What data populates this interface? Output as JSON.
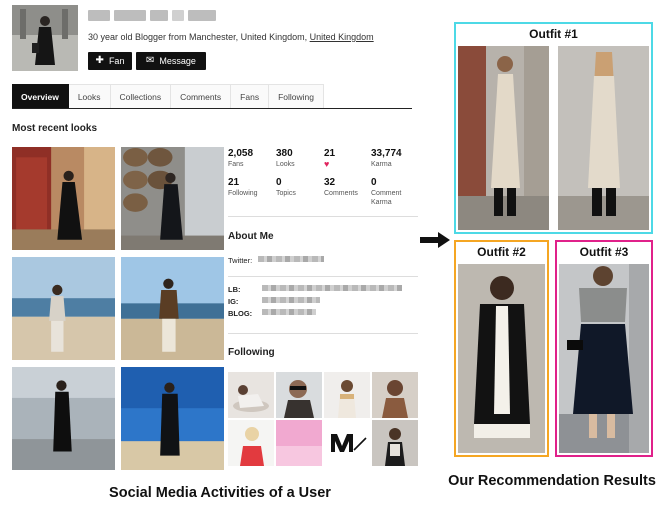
{
  "profile": {
    "bio": "30 year old Blogger from Manchester, United Kingdom, ",
    "bio_link": "United Kingdom",
    "fan_label": "Fan",
    "message_label": "Message"
  },
  "tabs": [
    "Overview",
    "Looks",
    "Collections",
    "Comments",
    "Fans",
    "Following"
  ],
  "recent_looks": {
    "heading": "Most recent looks"
  },
  "stats": [
    {
      "value": "2,058",
      "label": "Fans"
    },
    {
      "value": "380",
      "label": "Looks"
    },
    {
      "value": "21",
      "label": "♥"
    },
    {
      "value": "33,774",
      "label": "Karma"
    },
    {
      "value": "21",
      "label": "Following"
    },
    {
      "value": "0",
      "label": "Topics"
    },
    {
      "value": "32",
      "label": "Comments"
    },
    {
      "value": "0",
      "label": "Comment Karma"
    }
  ],
  "about": {
    "heading": "About Me",
    "twitter_label": "Twitter:",
    "lb_label": "LB:",
    "ig_label": "IG:",
    "blog_label": "BLOG:"
  },
  "following": {
    "heading": "Following"
  },
  "outfits": {
    "o1": {
      "title": "Outfit #1",
      "color": "#4dd9e6"
    },
    "o2": {
      "title": "Outfit #2",
      "color": "#f5a623"
    },
    "o3": {
      "title": "Outfit #3",
      "color": "#e0218a"
    }
  },
  "captions": {
    "left": "Social Media Activities of a User",
    "right": "Our Recommendation Results"
  }
}
